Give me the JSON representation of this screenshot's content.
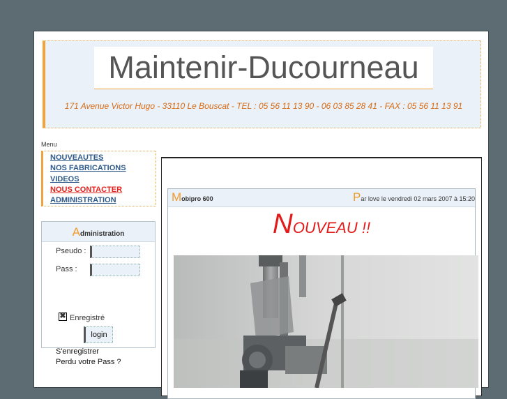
{
  "header": {
    "title": "Maintenir-Ducourneau",
    "address": "171 Avenue Victor Hugo - 33110 Le Bouscat - TEL : 05 56 11 13 90 - 06 03 85 28 41 - FAX : 05 56 11 13 91"
  },
  "menu": {
    "label": "Menu",
    "items": [
      {
        "label": "NOUVEAUTES"
      },
      {
        "label": "NOS FABRICATIONS"
      },
      {
        "label": "VIDEOS"
      },
      {
        "label": "NOUS CONTACTER"
      },
      {
        "label": "ADMINISTRATION"
      }
    ]
  },
  "admin": {
    "title_first": "A",
    "title_rest": "dministration",
    "pseudo_label": "Pseudo :",
    "pass_label": "Pass :",
    "remember_label": "Enregistré",
    "remember_mark": "✖",
    "login_label": "login",
    "register_link": "S'enregistrer",
    "lost_pass_link": "Perdu votre Pass ?"
  },
  "article": {
    "title_first": "M",
    "title_rest": "obipro 600",
    "byline_first": "P",
    "byline_rest": "ar love le vendredi 02 mars 2007 à 15:20",
    "headline_first": "N",
    "headline_rest": "OUVEAU !!"
  },
  "colors": {
    "background": "#5c6c72",
    "accent": "#f29a2a",
    "link": "#2e5a8a",
    "alert": "#e0201b",
    "header_bg": "#eaf1f8"
  }
}
